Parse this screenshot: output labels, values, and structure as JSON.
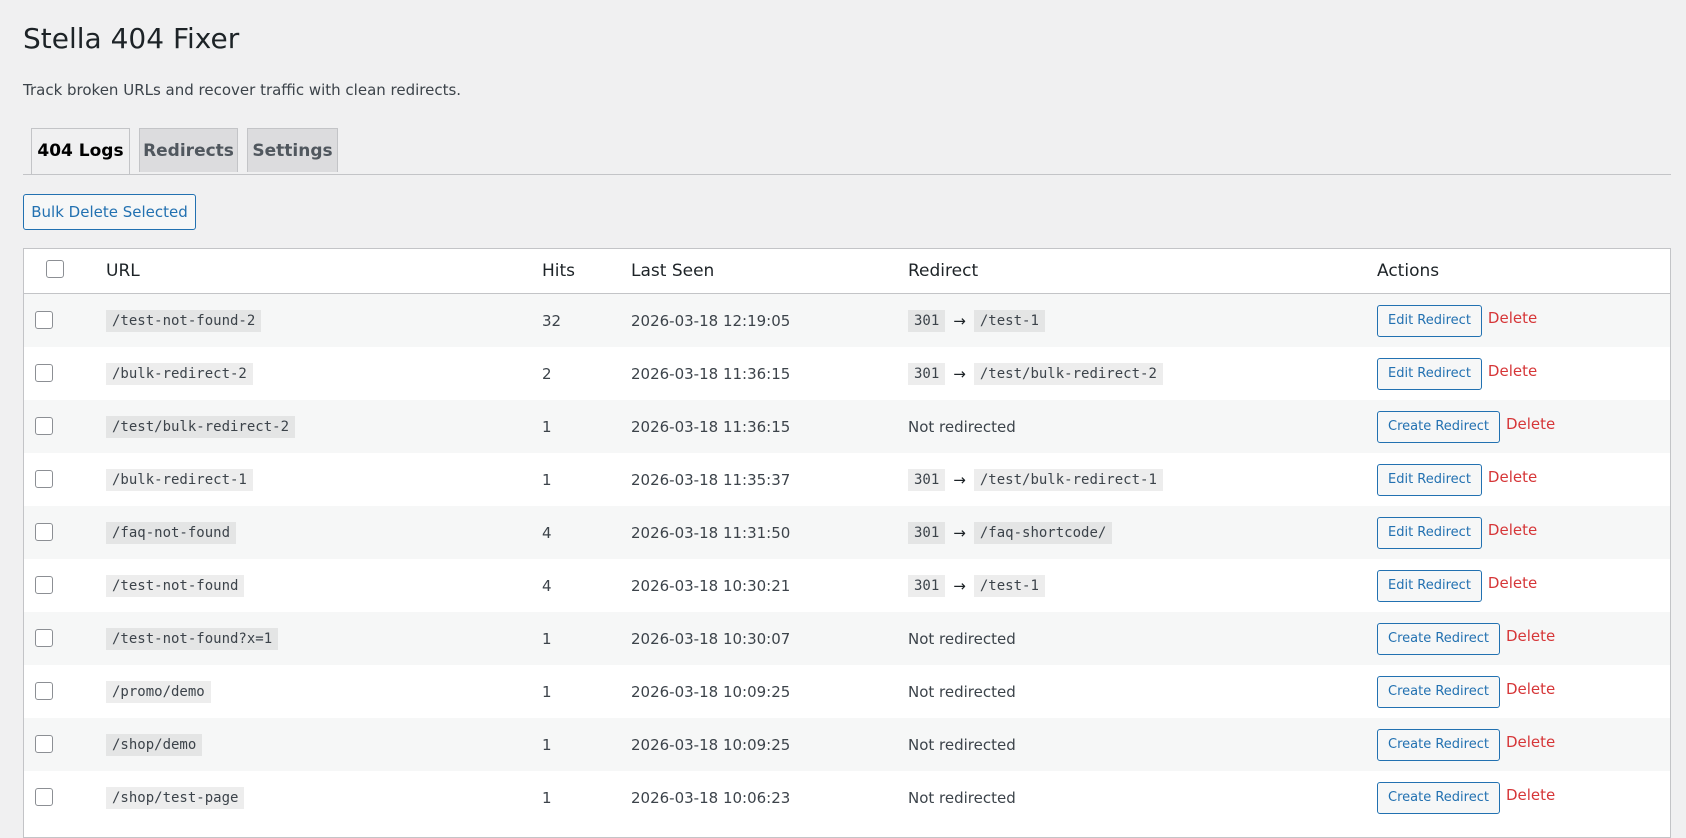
{
  "page": {
    "title": "Stella 404 Fixer",
    "description": "Track broken URLs and recover traffic with clean redirects."
  },
  "tabs": [
    {
      "label": "404 Logs",
      "active": true
    },
    {
      "label": "Redirects",
      "active": false
    },
    {
      "label": "Settings",
      "active": false
    }
  ],
  "toolbar": {
    "bulk_delete_label": "Bulk Delete Selected"
  },
  "table": {
    "columns": {
      "url": "URL",
      "hits": "Hits",
      "last_seen": "Last Seen",
      "redirect": "Redirect",
      "actions": "Actions"
    },
    "rows": [
      {
        "url": "/test-not-found-2",
        "hits": "32",
        "last_seen": "2026-03-18 12:19:05",
        "redirected": true,
        "code": "301",
        "arrow": "→",
        "target": "/test-1",
        "action_label": "Edit Redirect",
        "delete_label": "Delete"
      },
      {
        "url": "/bulk-redirect-2",
        "hits": "2",
        "last_seen": "2026-03-18 11:36:15",
        "redirected": true,
        "code": "301",
        "arrow": "→",
        "target": "/test/bulk-redirect-2",
        "action_label": "Edit Redirect",
        "delete_label": "Delete"
      },
      {
        "url": "/test/bulk-redirect-2",
        "hits": "1",
        "last_seen": "2026-03-18 11:36:15",
        "redirected": false,
        "status_text": "Not redirected",
        "action_label": "Create Redirect",
        "delete_label": "Delete"
      },
      {
        "url": "/bulk-redirect-1",
        "hits": "1",
        "last_seen": "2026-03-18 11:35:37",
        "redirected": true,
        "code": "301",
        "arrow": "→",
        "target": "/test/bulk-redirect-1",
        "action_label": "Edit Redirect",
        "delete_label": "Delete"
      },
      {
        "url": "/faq-not-found",
        "hits": "4",
        "last_seen": "2026-03-18 11:31:50",
        "redirected": true,
        "code": "301",
        "arrow": "→",
        "target": "/faq-shortcode/",
        "action_label": "Edit Redirect",
        "delete_label": "Delete"
      },
      {
        "url": "/test-not-found",
        "hits": "4",
        "last_seen": "2026-03-18 10:30:21",
        "redirected": true,
        "code": "301",
        "arrow": "→",
        "target": "/test-1",
        "action_label": "Edit Redirect",
        "delete_label": "Delete"
      },
      {
        "url": "/test-not-found?x=1",
        "hits": "1",
        "last_seen": "2026-03-18 10:30:07",
        "redirected": false,
        "status_text": "Not redirected",
        "action_label": "Create Redirect",
        "delete_label": "Delete"
      },
      {
        "url": "/promo/demo",
        "hits": "1",
        "last_seen": "2026-03-18 10:09:25",
        "redirected": false,
        "status_text": "Not redirected",
        "action_label": "Create Redirect",
        "delete_label": "Delete"
      },
      {
        "url": "/shop/demo",
        "hits": "1",
        "last_seen": "2026-03-18 10:09:25",
        "redirected": false,
        "status_text": "Not redirected",
        "action_label": "Create Redirect",
        "delete_label": "Delete"
      },
      {
        "url": "/shop/test-page",
        "hits": "1",
        "last_seen": "2026-03-18 10:06:23",
        "redirected": false,
        "status_text": "Not redirected",
        "action_label": "Create Redirect",
        "delete_label": "Delete"
      }
    ]
  },
  "colors": {
    "accent": "#2271b1",
    "delete": "#d63638",
    "background": "#f0f0f1"
  }
}
